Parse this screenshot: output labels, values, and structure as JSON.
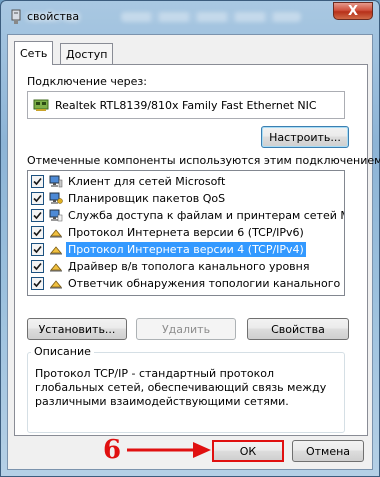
{
  "window": {
    "title": "свойства",
    "close_label": "X"
  },
  "tabs": [
    {
      "label": "Сеть"
    },
    {
      "label": "Доступ"
    }
  ],
  "connection": {
    "label": "Подключение через:",
    "adapter_name": "Realtek RTL8139/810x Family Fast Ethernet NIC",
    "configure_button": "Настроить..."
  },
  "components": {
    "label": "Отмеченные компоненты используются этим подключением:",
    "items": [
      {
        "label": "Клиент для сетей Microsoft",
        "checked": true,
        "icon": "network-client-icon"
      },
      {
        "label": "Планировщик пакетов QoS",
        "checked": true,
        "icon": "qos-service-icon"
      },
      {
        "label": "Служба доступа к файлам и принтерам сетей Micro...",
        "checked": true,
        "icon": "file-printer-sharing-icon"
      },
      {
        "label": "Протокол Интернета версии 6 (TCP/IPv6)",
        "checked": true,
        "icon": "protocol-icon"
      },
      {
        "label": "Протокол Интернета версии 4 (TCP/IPv4)",
        "checked": true,
        "icon": "protocol-icon",
        "selected": true
      },
      {
        "label": "Драйвер в/в тополога канального уровня",
        "checked": true,
        "icon": "protocol-icon"
      },
      {
        "label": "Ответчик обнаружения топологии канального уровня",
        "checked": true,
        "icon": "protocol-icon"
      }
    ]
  },
  "actions": {
    "install": "Установить...",
    "remove": "Удалить",
    "properties": "Свойства"
  },
  "description": {
    "title": "Описание",
    "text": "Протокол TCP/IP - стандартный протокол глобальных сетей, обеспечивающий связь между различными взаимодействующими сетями."
  },
  "footer": {
    "ok": "ОК",
    "cancel": "Отмена"
  },
  "annotation": {
    "step_number": "6",
    "color": "#e01010"
  },
  "colors": {
    "selection": "#3399ff",
    "title_glass": "#8db4d6"
  }
}
